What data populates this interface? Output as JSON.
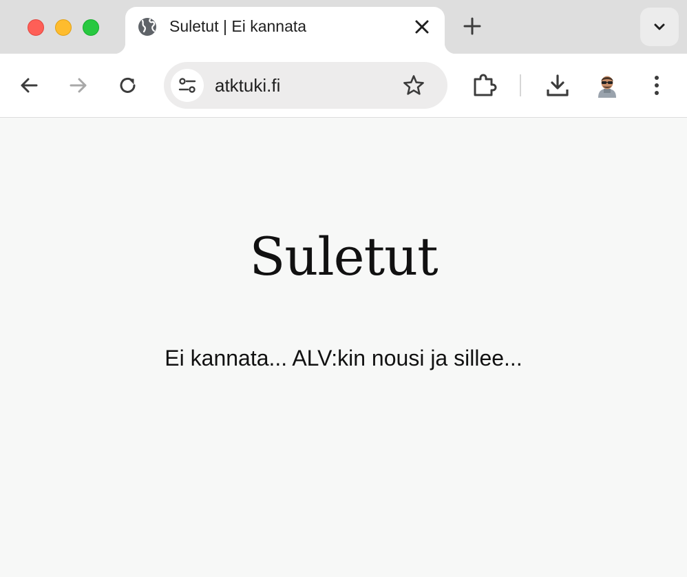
{
  "window": {
    "controls": [
      "close",
      "minimize",
      "maximize"
    ]
  },
  "tab": {
    "title": "Suletut | Ei kannata",
    "favicon": "globe-icon"
  },
  "toolbar": {
    "url": "atktuki.fi",
    "icons": [
      "back-icon",
      "forward-icon",
      "reload-icon",
      "site-info-icon",
      "bookmark-star-icon",
      "extensions-icon",
      "download-icon",
      "profile-avatar",
      "more-menu-icon"
    ]
  },
  "page": {
    "heading": "Suletut",
    "text": "Ei kannata... ALV:kin nousi ja sillee..."
  },
  "colors": {
    "tabbar": "#dedede",
    "page_background": "#f7f8f7",
    "close": "#fe5f57",
    "minimize": "#febc2e",
    "maximize": "#28c840"
  }
}
